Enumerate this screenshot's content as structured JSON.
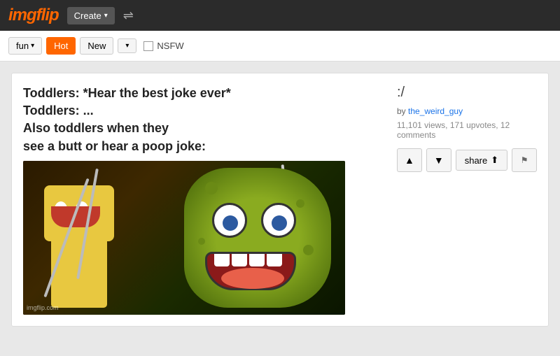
{
  "header": {
    "logo_text": "img",
    "logo_italic": "flip",
    "create_label": "Create",
    "shuffle_symbol": "⇌"
  },
  "filter_bar": {
    "fun_label": "fun",
    "hot_label": "Hot",
    "new_label": "New",
    "nsfw_label": "NSFW"
  },
  "meme": {
    "title": "Toddlers: *Hear the best joke ever*\nToddlers: ...\n    Also toddlers when they\nsee a butt or hear a poop joke:",
    "caption": ":/",
    "author": "the_weird_guy",
    "views": "11,101 views",
    "upvotes": "171 upvotes",
    "comments": "12 comments",
    "stats_text": "11,101 views, 171 upvotes, 12 comments",
    "share_label": "share",
    "watermark": "imgflip.com",
    "upvote_symbol": "▲",
    "downvote_symbol": "▼",
    "flag_symbol": "⚑"
  }
}
